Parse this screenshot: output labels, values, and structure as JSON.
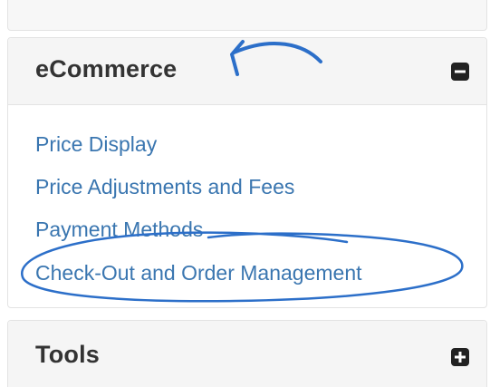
{
  "ecommerce_panel": {
    "title": "eCommerce",
    "toggle_icon": "minus-square-icon",
    "links": [
      "Price Display",
      "Price Adjustments and Fees",
      "Payment Methods",
      "Check-Out and Order Management"
    ]
  },
  "tools_panel": {
    "title": "Tools",
    "toggle_icon": "plus-square-icon"
  },
  "colors": {
    "link": "#3a76b0",
    "annotation": "#2c6fc9",
    "header_bg": "#f5f5f5",
    "title_text": "#333333"
  }
}
